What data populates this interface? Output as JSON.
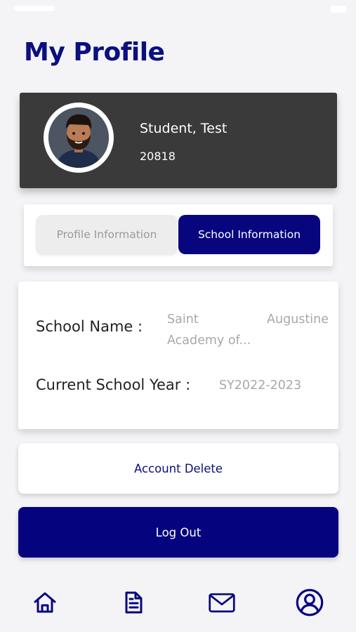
{
  "page": {
    "title": "My Profile"
  },
  "profile": {
    "name": "Student, Test",
    "student_id": "20818"
  },
  "tabs": [
    {
      "label": "Profile Information",
      "active": false
    },
    {
      "label": "School Information",
      "active": true
    }
  ],
  "school_info": {
    "school_name_label": "School Name :",
    "school_name_value_word1": "Saint",
    "school_name_value_word2": "Augustine",
    "school_name_value_line2": "Academy of...",
    "school_year_label": "Current School Year :",
    "school_year_value": "SY2022-2023"
  },
  "actions": {
    "delete_label": "Account Delete",
    "logout_label": "Log Out"
  },
  "bottom_nav": [
    {
      "icon": "home-icon"
    },
    {
      "icon": "document-icon"
    },
    {
      "icon": "mail-icon"
    },
    {
      "icon": "profile-icon",
      "active": true
    }
  ],
  "colors": {
    "primary": "#08067f",
    "card_dark": "#3a3a3a",
    "background": "#f4f4f6"
  }
}
